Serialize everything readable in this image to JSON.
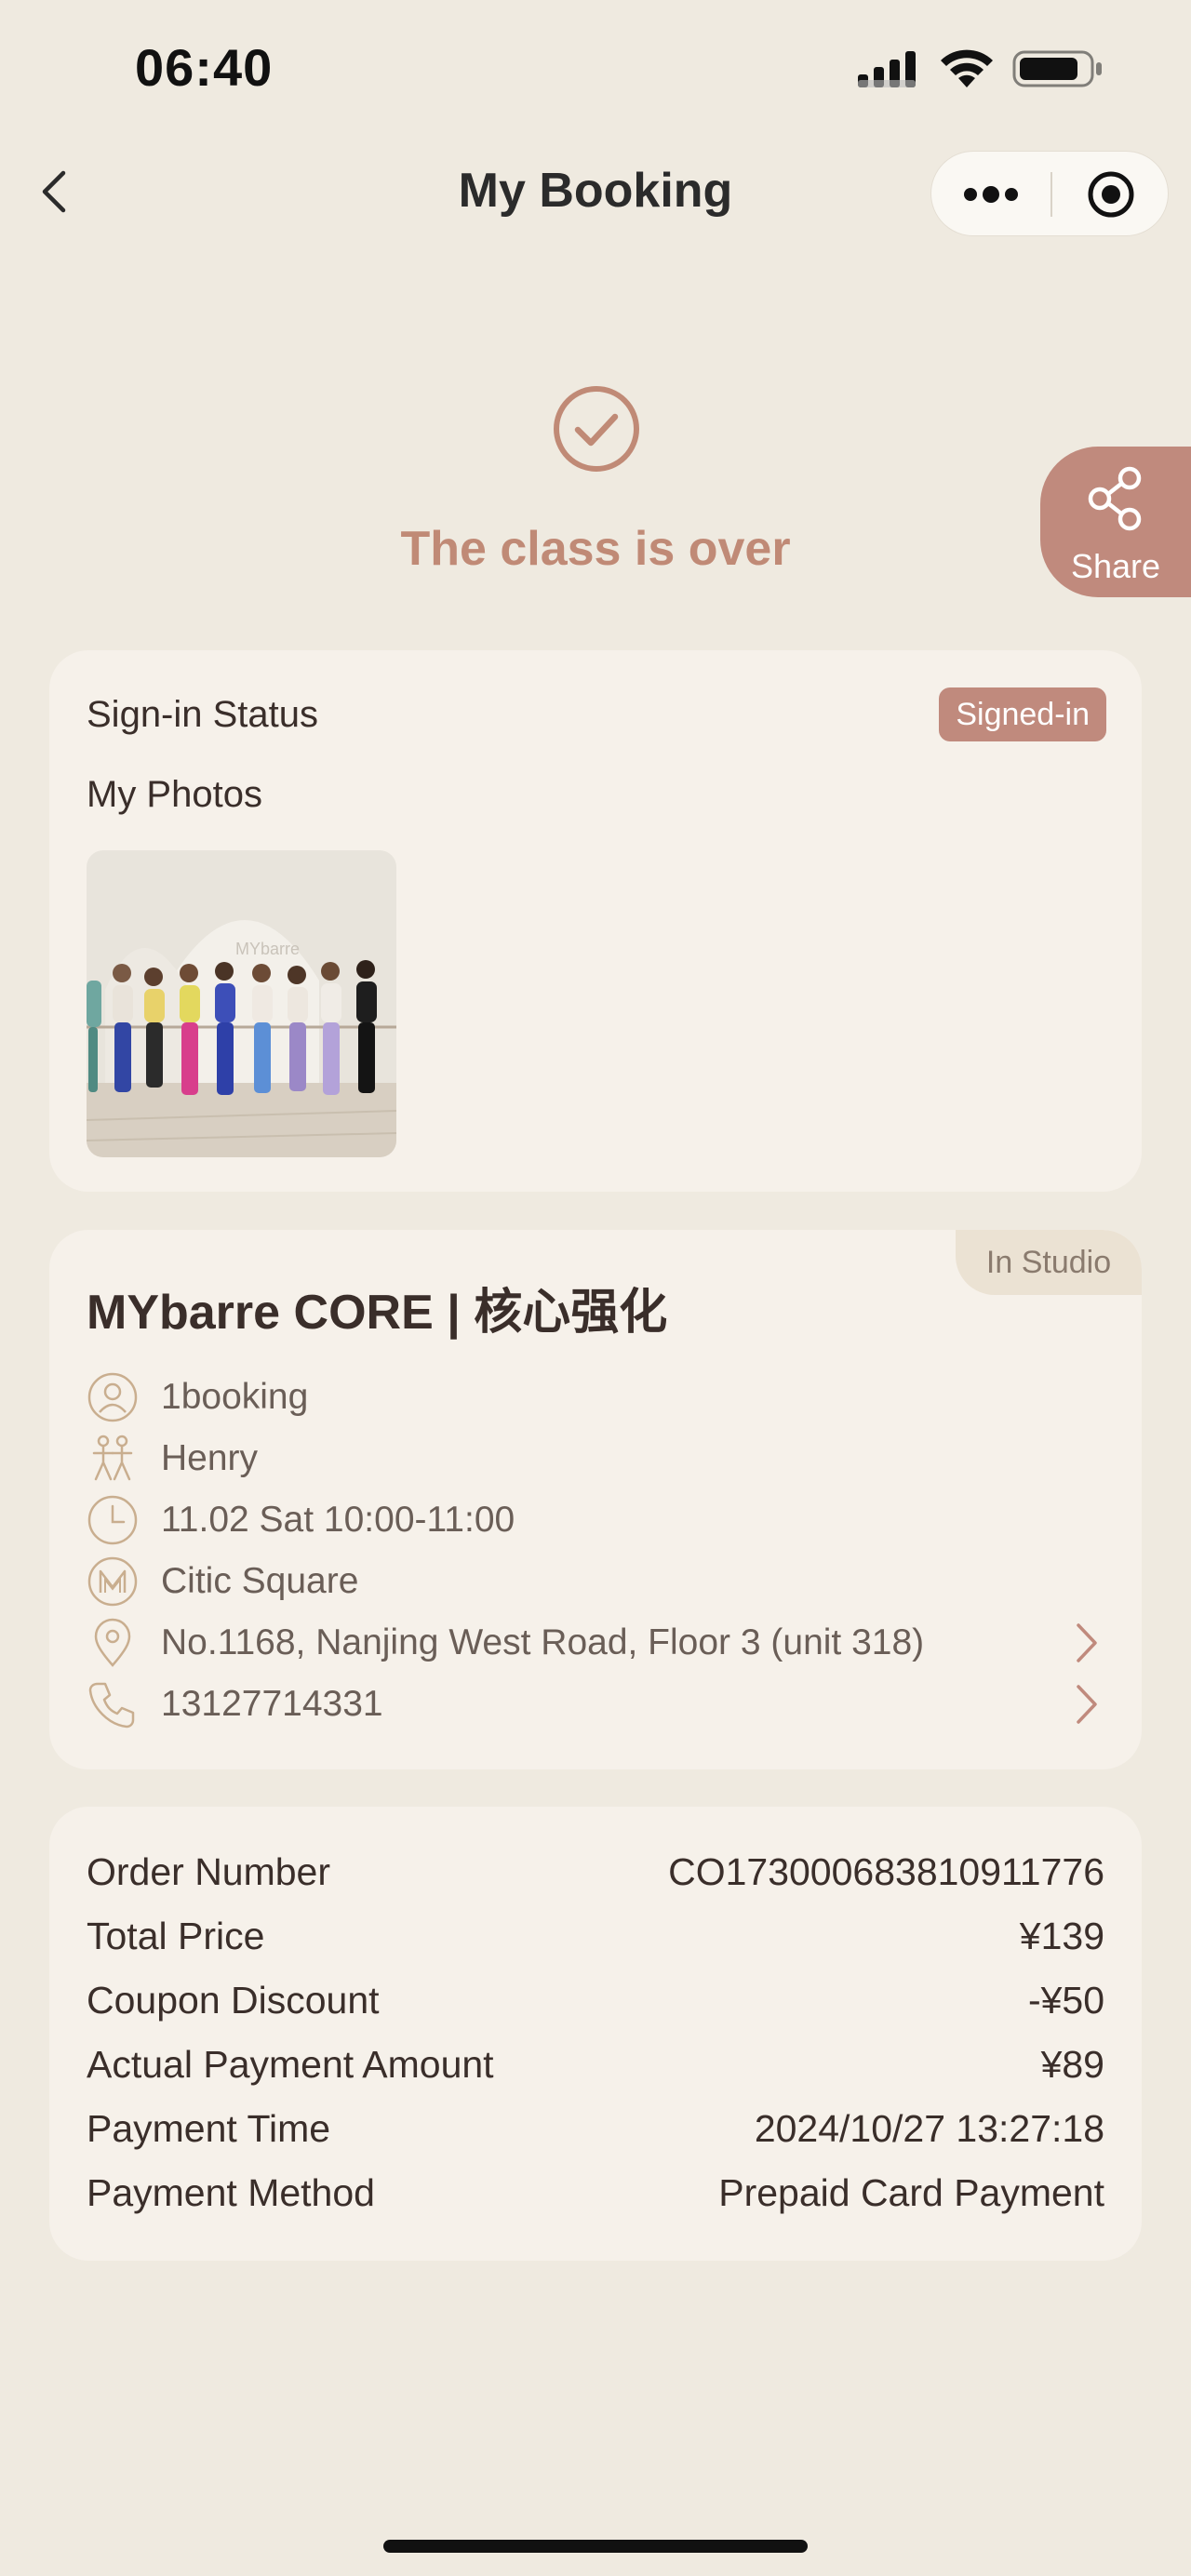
{
  "status_bar": {
    "time": "06:40"
  },
  "nav": {
    "title": "My Booking"
  },
  "result": {
    "text": "The class is over"
  },
  "share": {
    "label": "Share"
  },
  "signin": {
    "label": "Sign-in Status",
    "badge": "Signed-in",
    "photos_label": "My Photos",
    "photo_watermark": "MYbarre"
  },
  "class_card": {
    "tag": "In Studio",
    "title": "MYbarre CORE | 核心强化",
    "rows": [
      {
        "icon": "user-icon",
        "text": "1booking"
      },
      {
        "icon": "instructor-icon",
        "text": "Henry"
      },
      {
        "icon": "clock-icon",
        "text": "11.02 Sat 10:00-11:00"
      },
      {
        "icon": "studio-logo-icon",
        "text": "Citic Square"
      },
      {
        "icon": "location-pin-icon",
        "text": "No.1168, Nanjing West Road, Floor 3 (unit 318)"
      },
      {
        "icon": "phone-icon",
        "text": "13127714331"
      }
    ]
  },
  "order": {
    "rows": [
      {
        "label": "Order Number",
        "value": "CO173000683810911776"
      },
      {
        "label": "Total Price",
        "value": "¥139"
      },
      {
        "label": "Coupon Discount",
        "value": "-¥50"
      },
      {
        "label": "Actual Payment Amount",
        "value": "¥89"
      },
      {
        "label": "Payment Time",
        "value": "2024/10/27 13:27:18"
      },
      {
        "label": "Payment Method",
        "value": "Prepaid Card Payment"
      }
    ]
  },
  "colors": {
    "accent": "#C08A7D",
    "background": "#EFEAE0",
    "card": "#F6F1EA"
  }
}
